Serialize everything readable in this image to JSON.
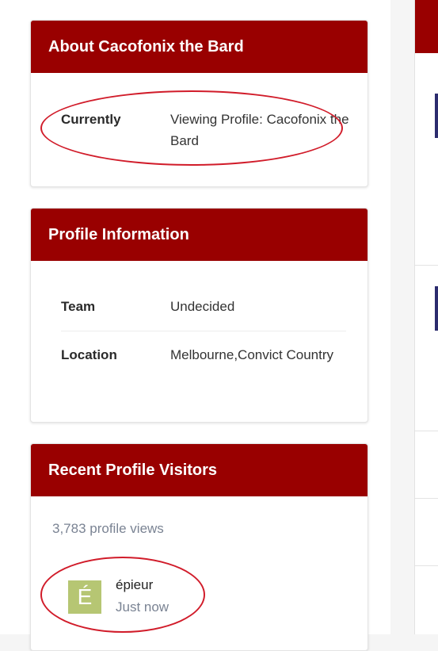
{
  "about": {
    "title": "About Cacofonix the Bard",
    "currently_label": "Currently",
    "currently_value": "Viewing Profile: Cacofonix the Bard"
  },
  "profile_info": {
    "title": "Profile Information",
    "rows": [
      {
        "label": "Team",
        "value": "Undecided"
      },
      {
        "label": "Location",
        "value": "Melbourne,Convict Country"
      }
    ]
  },
  "visitors": {
    "title": "Recent Profile Visitors",
    "views": "3,783 profile views",
    "items": [
      {
        "initial": "É",
        "name": "épieur",
        "time": "Just now"
      }
    ]
  },
  "colors": {
    "header_bg": "#990000",
    "annotation": "#d11c2a",
    "avatar_bg": "#b6c673"
  }
}
